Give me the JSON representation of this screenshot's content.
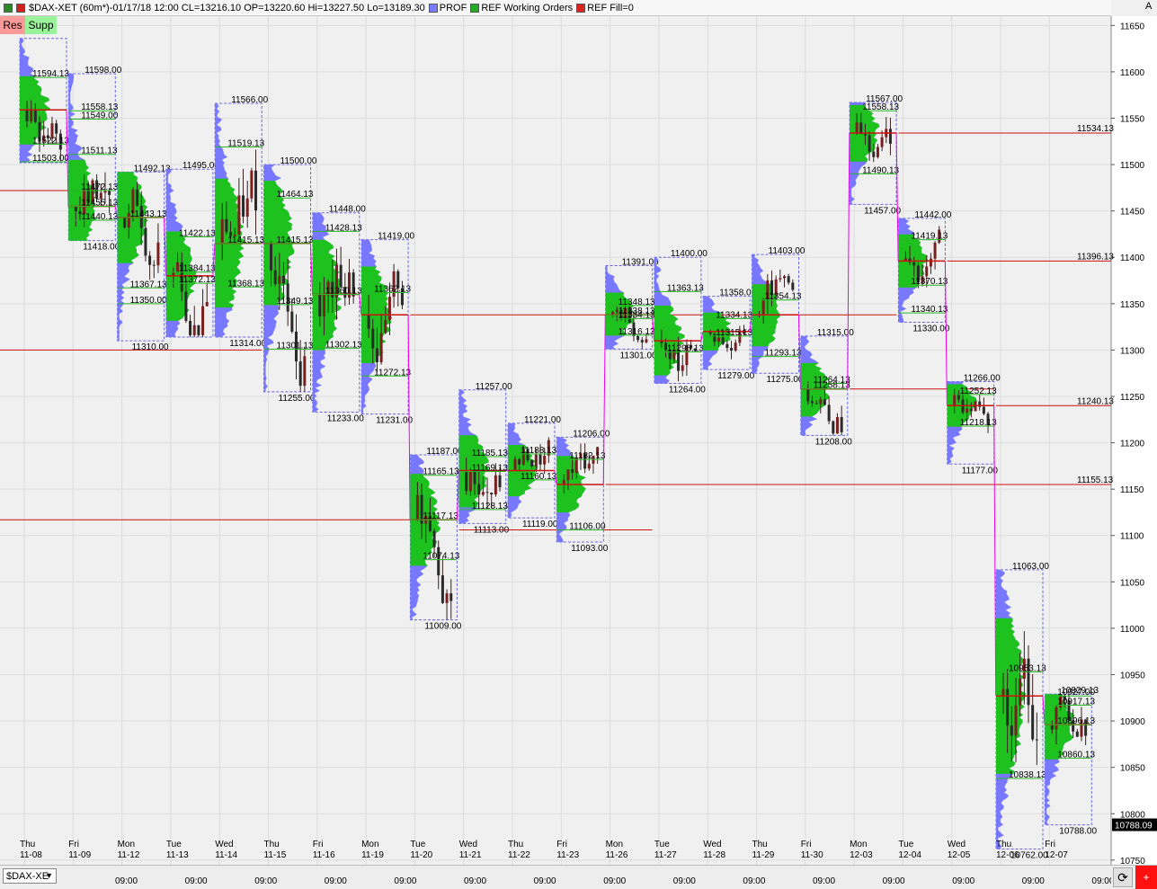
{
  "toolbar": {
    "title": "$DAX-XET (60m*)-01/17/18 12:00 CL=13216.10 OP=13220.60 Hi=13227.50 Lo=13189.30",
    "legend": [
      {
        "label": "PROF",
        "color": "#7b7bff"
      },
      {
        "label": "REF Working Orders",
        "color": "#22aa22"
      },
      {
        "label": "REF Fill=0",
        "color": "#dd2222"
      }
    ],
    "res_label": "Res",
    "supp_label": "Supp",
    "axis_button": "A"
  },
  "bottom": {
    "symbol": "$DAX-XE",
    "time_labels": [
      "09:00",
      "09:00",
      "09:00",
      "09:00",
      "09:00",
      "09:00",
      "09:00",
      "09:00",
      "09:00",
      "09:00",
      "09:00",
      "09:00",
      "09:00",
      "09:00",
      "09:00",
      "09:00"
    ],
    "refresh_icon": "refresh-icon",
    "red_icon": "add-icon"
  },
  "colors": {
    "profile_blue": "#7777ff",
    "profile_green": "#1ec21e",
    "ref_line": "#cc1111",
    "connector": "#ee00ee",
    "box_border": "#6666dd",
    "candle": "#3a2020"
  },
  "chart_data": {
    "type": "market-profile",
    "ylim": [
      10745,
      11660
    ],
    "yticks": [
      11650,
      11600,
      11550,
      11500,
      11450,
      11400,
      11350,
      11300,
      11250,
      11200,
      11150,
      11100,
      11050,
      11000,
      10950,
      10900,
      10850,
      10800,
      10750
    ],
    "last_price": "10788.09",
    "days": [
      {
        "day": "Thu",
        "date": "11-08",
        "hi": 11636,
        "lo": 11502,
        "poc": 11559,
        "lbl_hi": "",
        "lbl_lo": "",
        "labels": [
          {
            "t": "11594.13",
            "v": 11594
          },
          {
            "t": "11522.13",
            "v": 11522
          },
          {
            "t": "11503.00",
            "v": 11503
          }
        ]
      },
      {
        "day": "Fri",
        "date": "11-09",
        "hi": 11598,
        "lo": 11418,
        "poc": 11455,
        "lbl_hi": "11598.00",
        "lbl_lo": "11418.00",
        "labels": [
          {
            "t": "11558.13",
            "v": 11558
          },
          {
            "t": "11549.00",
            "v": 11549
          },
          {
            "t": "11511.13",
            "v": 11511
          },
          {
            "t": "11472.13",
            "v": 11472
          },
          {
            "t": "11455.13",
            "v": 11455
          },
          {
            "t": "11440.13",
            "v": 11440
          }
        ]
      },
      {
        "day": "Mon",
        "date": "11-12",
        "hi": 11492,
        "lo": 11310,
        "poc": 11443,
        "lbl_hi": "11492.13",
        "lbl_lo": "11310.00",
        "labels": [
          {
            "t": "11443.13",
            "v": 11443
          },
          {
            "t": "11367.13",
            "v": 11367
          },
          {
            "t": "11350.00",
            "v": 11350
          }
        ]
      },
      {
        "day": "Tue",
        "date": "11-13",
        "hi": 11495,
        "lo": 11314,
        "poc": 11380,
        "lbl_hi": "11495.00",
        "lbl_lo": "",
        "labels": [
          {
            "t": "11422.13",
            "v": 11422
          },
          {
            "t": "11384.13",
            "v": 11384
          },
          {
            "t": "11372.13",
            "v": 11372
          }
        ]
      },
      {
        "day": "Wed",
        "date": "11-14",
        "hi": 11566,
        "lo": 11314,
        "poc": 11415,
        "lbl_hi": "11566.00",
        "lbl_lo": "11314.00",
        "labels": [
          {
            "t": "11519.13",
            "v": 11519
          },
          {
            "t": "11415.13",
            "v": 11415
          },
          {
            "t": "11368.13",
            "v": 11368
          }
        ]
      },
      {
        "day": "Thu",
        "date": "11-15",
        "hi": 11500,
        "lo": 11255,
        "poc": 11415,
        "lbl_hi": "11500.00",
        "lbl_lo": "11255.00",
        "labels": [
          {
            "t": "11464.13",
            "v": 11464
          },
          {
            "t": "11415.13",
            "v": 11415
          },
          {
            "t": "11349.13",
            "v": 11349
          },
          {
            "t": "11301.13",
            "v": 11301
          }
        ]
      },
      {
        "day": "Fri",
        "date": "11-16",
        "hi": 11448,
        "lo": 11233,
        "poc": 11360,
        "lbl_hi": "11448.00",
        "lbl_lo": "11233.00",
        "labels": [
          {
            "t": "11428.13",
            "v": 11428
          },
          {
            "t": "11360.13",
            "v": 11360
          },
          {
            "t": "11302.13",
            "v": 11302
          }
        ]
      },
      {
        "day": "Mon",
        "date": "11-19",
        "hi": 11419,
        "lo": 11231,
        "poc": 11338,
        "lbl_hi": "11419.00",
        "lbl_lo": "11231.00",
        "labels": [
          {
            "t": "11362.13",
            "v": 11362
          },
          {
            "t": "11272.13",
            "v": 11272
          }
        ]
      },
      {
        "day": "Tue",
        "date": "11-20",
        "hi": 11187,
        "lo": 11009,
        "poc": 11117,
        "lbl_hi": "11187.00",
        "lbl_lo": "11009.00",
        "labels": [
          {
            "t": "11165.13",
            "v": 11165
          },
          {
            "t": "11117.13",
            "v": 11117
          },
          {
            "t": "11074.13",
            "v": 11074
          }
        ]
      },
      {
        "day": "Wed",
        "date": "11-21",
        "hi": 11257,
        "lo": 11113,
        "poc": 11170,
        "lbl_hi": "11257.00",
        "lbl_lo": "11113.00",
        "labels": [
          {
            "t": "11185.13",
            "v": 11185
          },
          {
            "t": "11169.13",
            "v": 11169
          },
          {
            "t": "11128.13",
            "v": 11128
          }
        ]
      },
      {
        "day": "Thu",
        "date": "11-22",
        "hi": 11221,
        "lo": 11119,
        "poc": 11170,
        "lbl_hi": "11221.00",
        "lbl_lo": "11119.00",
        "labels": [
          {
            "t": "11188.13",
            "v": 11188
          },
          {
            "t": "11160.13",
            "v": 11160
          }
        ]
      },
      {
        "day": "Fri",
        "date": "11-23",
        "hi": 11206,
        "lo": 11093,
        "poc": 11155,
        "lbl_hi": "11206.00",
        "lbl_lo": "11093.00",
        "labels": [
          {
            "t": "11182.13",
            "v": 11182
          },
          {
            "t": "11106.00",
            "v": 11106
          }
        ]
      },
      {
        "day": "Mon",
        "date": "11-26",
        "hi": 11391,
        "lo": 11301,
        "poc": 11338,
        "lbl_hi": "11391.00",
        "lbl_lo": "11301.00",
        "labels": [
          {
            "t": "11338.13",
            "v": 11338
          },
          {
            "t": "11348.13",
            "v": 11348
          },
          {
            "t": "11334.13",
            "v": 11334
          },
          {
            "t": "11316.13",
            "v": 11316
          }
        ]
      },
      {
        "day": "Tue",
        "date": "11-27",
        "hi": 11400,
        "lo": 11264,
        "poc": 11310,
        "lbl_hi": "11400.00",
        "lbl_lo": "11264.00",
        "labels": [
          {
            "t": "11363.13",
            "v": 11363
          },
          {
            "t": "11298.13",
            "v": 11298
          }
        ]
      },
      {
        "day": "Wed",
        "date": "11-28",
        "hi": 11358,
        "lo": 11279,
        "poc": 11320,
        "lbl_hi": "11358.00",
        "lbl_lo": "11279.00",
        "labels": [
          {
            "t": "11334.13",
            "v": 11334
          },
          {
            "t": "11315.13",
            "v": 11315
          }
        ]
      },
      {
        "day": "Thu",
        "date": "11-29",
        "hi": 11403,
        "lo": 11275,
        "poc": 11338,
        "lbl_hi": "11403.00",
        "lbl_lo": "11275.00",
        "labels": [
          {
            "t": "11354.13",
            "v": 11354
          },
          {
            "t": "11293.13",
            "v": 11293
          }
        ]
      },
      {
        "day": "Fri",
        "date": "11-30",
        "hi": 11315,
        "lo": 11208,
        "poc": 11258,
        "lbl_hi": "11315.00",
        "lbl_lo": "11208.00",
        "labels": [
          {
            "t": "11264.13",
            "v": 11264
          },
          {
            "t": "11258.13",
            "v": 11258
          }
        ]
      },
      {
        "day": "Mon",
        "date": "12-03",
        "hi": 11567,
        "lo": 11457,
        "poc": 11534,
        "lbl_hi": "11567.00",
        "lbl_lo": "11457.00",
        "labels": [
          {
            "t": "11558.13",
            "v": 11558
          },
          {
            "t": "11490.13",
            "v": 11490
          }
        ]
      },
      {
        "day": "Tue",
        "date": "12-04",
        "hi": 11442,
        "lo": 11330,
        "poc": 11396,
        "lbl_hi": "11442.00",
        "lbl_lo": "11330.00",
        "labels": [
          {
            "t": "11419.13",
            "v": 11419
          },
          {
            "t": "11370.13",
            "v": 11370
          },
          {
            "t": "11340.13",
            "v": 11340
          }
        ]
      },
      {
        "day": "Wed",
        "date": "12-05",
        "hi": 11266,
        "lo": 11177,
        "poc": 11240,
        "lbl_hi": "11266.00",
        "lbl_lo": "11177.00",
        "labels": [
          {
            "t": "11252.13",
            "v": 11252
          },
          {
            "t": "11218.13",
            "v": 11218
          }
        ]
      },
      {
        "day": "Thu",
        "date": "12-06",
        "hi": 11063,
        "lo": 10762,
        "poc": 10927,
        "lbl_hi": "11063.00",
        "lbl_lo": "10762.00",
        "labels": [
          {
            "t": "10953.13",
            "v": 10953
          },
          {
            "t": "10838.13",
            "v": 10838
          }
        ]
      },
      {
        "day": "Fri",
        "date": "12-07",
        "hi": 10929,
        "lo": 10788,
        "poc": 10896,
        "lbl_hi": "10929.13",
        "lbl_lo": "10788.00",
        "labels": [
          {
            "t": "10927.00",
            "v": 10927
          },
          {
            "t": "10917.13",
            "v": 10917
          },
          {
            "t": "10896.13",
            "v": 10896
          },
          {
            "t": "10860.13",
            "v": 10860
          }
        ]
      }
    ],
    "ref_lines": [
      {
        "label": "11534.13",
        "v": 11534,
        "from": 18
      },
      {
        "label": "11396.13",
        "v": 11396,
        "from": 19
      },
      {
        "label": "11240.13",
        "v": 11240,
        "from": 20
      },
      {
        "label": "11155.13",
        "v": 11155,
        "from": 12
      },
      {
        "label": "",
        "v": 11472,
        "from": 0,
        "to": 1
      },
      {
        "label": "",
        "v": 11300,
        "from": 0,
        "to": 4
      },
      {
        "label": "",
        "v": 11338,
        "from": 8,
        "to": 17
      },
      {
        "label": "",
        "v": 11258,
        "from": 17,
        "to": 19
      },
      {
        "label": "",
        "v": 11117,
        "from": 0,
        "to": 8
      },
      {
        "label": "",
        "v": 11106,
        "from": 9,
        "to": 12
      }
    ]
  }
}
